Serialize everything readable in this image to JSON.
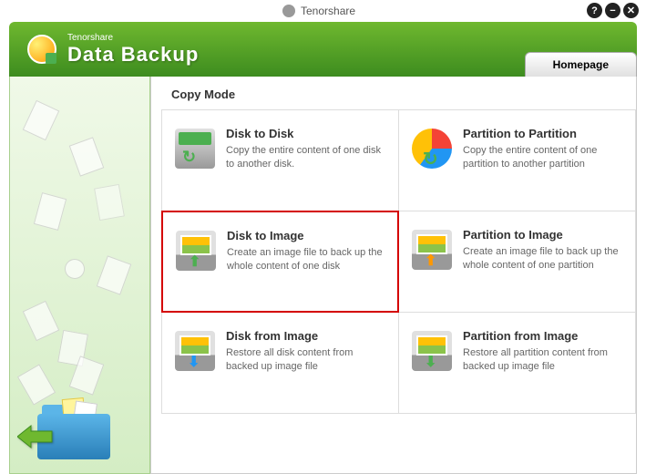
{
  "titlebar": {
    "brand": "Tenorshare"
  },
  "header": {
    "small": "Tenorshare",
    "large": "Data Backup",
    "tab": "Homepage"
  },
  "section_title": "Copy Mode",
  "cards": [
    {
      "title": "Disk to Disk",
      "desc": "Copy the entire content of one disk to another disk."
    },
    {
      "title": "Partition to Partition",
      "desc": "Copy the entire content of one partition to another partition"
    },
    {
      "title": "Disk to Image",
      "desc": "Create an image file to back up the whole content of one disk"
    },
    {
      "title": "Partition to Image",
      "desc": "Create an image file to back up the whole content of one partition"
    },
    {
      "title": "Disk from Image",
      "desc": "Restore all disk content from backed up image file"
    },
    {
      "title": "Partition from Image",
      "desc": "Restore all partition content from backed up image file"
    }
  ]
}
